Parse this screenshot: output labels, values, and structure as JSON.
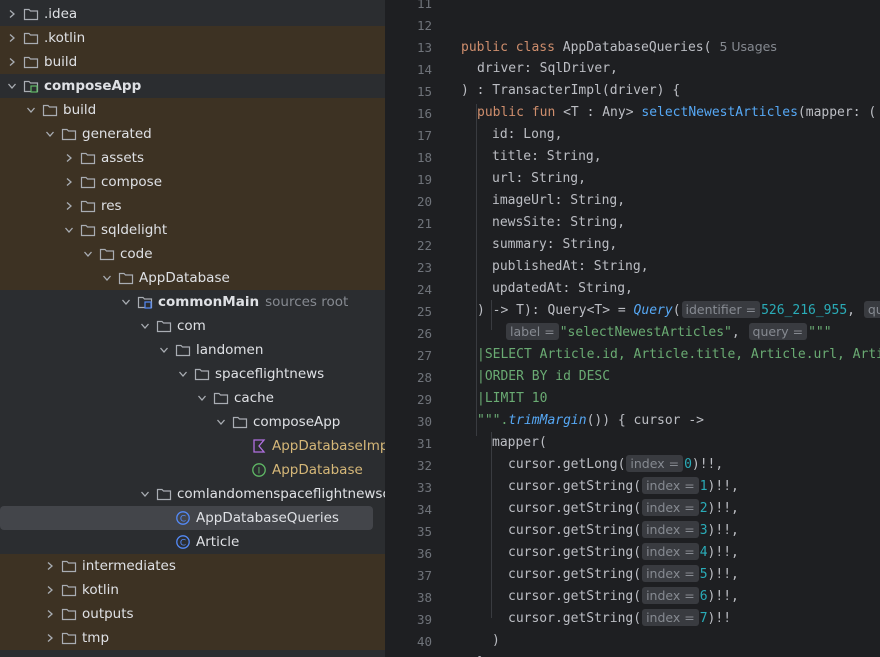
{
  "project_tree": {
    "rows": [
      {
        "label": ".idea",
        "icon": "folder-icon",
        "arrow": "right",
        "excluded": false
      },
      {
        "label": ".kotlin",
        "icon": "folder-icon",
        "arrow": "right",
        "excluded": true
      },
      {
        "label": "build",
        "icon": "folder-icon",
        "arrow": "right",
        "excluded": true
      },
      {
        "label": "composeApp",
        "icon": "module-folder-icon",
        "arrow": "down",
        "excluded": false,
        "bold": true
      },
      {
        "label": "build",
        "icon": "folder-icon",
        "arrow": "down",
        "excluded": true
      },
      {
        "label": "generated",
        "icon": "folder-icon",
        "arrow": "down",
        "excluded": true
      },
      {
        "label": "assets",
        "icon": "folder-icon",
        "arrow": "right",
        "excluded": true
      },
      {
        "label": "compose",
        "icon": "folder-icon",
        "arrow": "right",
        "excluded": true
      },
      {
        "label": "res",
        "icon": "folder-icon",
        "arrow": "right",
        "excluded": true
      },
      {
        "label": "sqldelight",
        "icon": "folder-icon",
        "arrow": "down",
        "excluded": true
      },
      {
        "label": "code",
        "icon": "folder-icon",
        "arrow": "down",
        "excluded": true
      },
      {
        "label": "AppDatabase",
        "icon": "folder-icon",
        "arrow": "down",
        "excluded": true
      },
      {
        "label": "commonMain",
        "icon": "source-root-icon",
        "arrow": "down",
        "excluded": false,
        "bold": true,
        "hint": "sources root"
      },
      {
        "label": "com",
        "icon": "folder-icon",
        "arrow": "down",
        "excluded": false
      },
      {
        "label": "landomen",
        "icon": "folder-icon",
        "arrow": "down",
        "excluded": false
      },
      {
        "label": "spaceflightnews",
        "icon": "folder-icon",
        "arrow": "down",
        "excluded": false
      },
      {
        "label": "cache",
        "icon": "folder-icon",
        "arrow": "down",
        "excluded": false
      },
      {
        "label": "composeApp",
        "icon": "folder-icon",
        "arrow": "down",
        "excluded": false
      },
      {
        "label": "AppDatabaseImpl.k",
        "icon": "kotlin-file-icon",
        "arrow": "none",
        "excluded": false,
        "color": "orange"
      },
      {
        "label": "AppDatabase",
        "icon": "interface-icon",
        "arrow": "none",
        "excluded": false,
        "color": "orange"
      },
      {
        "label": "comlandomenspaceflightnewscac",
        "icon": "folder-icon",
        "arrow": "down",
        "excluded": false
      },
      {
        "label": "AppDatabaseQueries",
        "icon": "class-icon",
        "arrow": "none",
        "excluded": false,
        "selected": true
      },
      {
        "label": "Article",
        "icon": "class-icon",
        "arrow": "none",
        "excluded": false
      },
      {
        "label": "intermediates",
        "icon": "folder-icon",
        "arrow": "right",
        "excluded": true
      },
      {
        "label": "kotlin",
        "icon": "folder-icon",
        "arrow": "right",
        "excluded": true
      },
      {
        "label": "outputs",
        "icon": "folder-icon",
        "arrow": "right",
        "excluded": true
      },
      {
        "label": "tmp",
        "icon": "folder-icon",
        "arrow": "right",
        "excluded": true
      }
    ]
  },
  "editor": {
    "line_numbers": [
      "11",
      "12",
      "13",
      "14",
      "15",
      "16",
      "17",
      "18",
      "19",
      "20",
      "21",
      "22",
      "23",
      "24",
      "25",
      "26",
      "27",
      "28",
      "29",
      "30",
      "31",
      "32",
      "33",
      "34",
      "35",
      "36",
      "37",
      "38",
      "39",
      "40"
    ],
    "lines": {
      "l12": {
        "kw1": "public class ",
        "name": "AppDatabaseQueries(",
        "usages": "5 Usages"
      },
      "l13": {
        "text": "driver: SqlDriver,"
      },
      "l14": {
        "text": ") : TransacterImpl(driver) {"
      },
      "l15": {
        "kw1": "public fun ",
        "gen": "<T : Any> ",
        "fn": "selectNewestArticles",
        "rest": "(mapper: ("
      },
      "l16": {
        "text": "id: Long,"
      },
      "l17": {
        "text": "title: String,"
      },
      "l18": {
        "text": "url: String,"
      },
      "l19": {
        "text": "imageUrl: String,"
      },
      "l20": {
        "text": "newsSite: String,"
      },
      "l21": {
        "text": "summary: String,"
      },
      "l22": {
        "text": "publishedAt: String,"
      },
      "l23": {
        "text": "updatedAt: String,"
      },
      "l24": {
        "pre": ") -> T): Query<T> = ",
        "query": "Query",
        "paren": "(",
        "hint": "identifier =",
        "num": "526_216_955",
        "tail": ", ",
        "hint2": "qu"
      },
      "l25": {
        "hint": "label =",
        "str": "\"selectNewestArticles\"",
        "sep": ", ",
        "hint2": "query =",
        "str2": "\"\"\""
      },
      "l26": {
        "text": "|SELECT Article.id, Article.title, Article.url, Arti"
      },
      "l27": {
        "text": "|ORDER BY id DESC"
      },
      "l28": {
        "text": "|LIMIT 10"
      },
      "l29": {
        "str": "\"\"\".",
        "fn": "trimMargin",
        "rest": "()) { cursor ->"
      },
      "l30": {
        "text": "mapper("
      },
      "cursor_rows": [
        {
          "call": "cursor.getLong(",
          "hint": "index =",
          "idx": "0",
          "end": ")!!,"
        },
        {
          "call": "cursor.getString(",
          "hint": "index =",
          "idx": "1",
          "end": ")!!,"
        },
        {
          "call": "cursor.getString(",
          "hint": "index =",
          "idx": "2",
          "end": ")!!,"
        },
        {
          "call": "cursor.getString(",
          "hint": "index =",
          "idx": "3",
          "end": ")!!,"
        },
        {
          "call": "cursor.getString(",
          "hint": "index =",
          "idx": "4",
          "end": ")!!,"
        },
        {
          "call": "cursor.getString(",
          "hint": "index =",
          "idx": "5",
          "end": ")!!,"
        },
        {
          "call": "cursor.getString(",
          "hint": "index =",
          "idx": "6",
          "end": ")!!,"
        },
        {
          "call": "cursor.getString(",
          "hint": "index =",
          "idx": "7",
          "end": ")!!"
        }
      ],
      "l39": {
        "text": ")"
      },
      "l40": {
        "text": "}"
      }
    }
  },
  "colors": {
    "tree_bg": "#2b2d30",
    "excluded_bg": "#3d3223",
    "editor_bg": "#1e1f22",
    "keyword": "#cf8e6d",
    "function": "#56a8f5",
    "string": "#6aab73",
    "number": "#2aacb8"
  }
}
